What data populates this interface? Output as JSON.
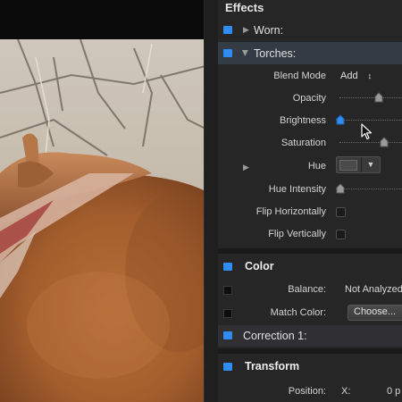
{
  "inspector": {
    "title": "Effects",
    "worn": {
      "label": "Worn:"
    },
    "torches": {
      "label": "Torches:",
      "blend_mode": {
        "label": "Blend Mode",
        "value": "Add",
        "arrow": "↕"
      },
      "opacity": {
        "label": "Opacity"
      },
      "brightness": {
        "label": "Brightness"
      },
      "saturation": {
        "label": "Saturation"
      },
      "hue": {
        "label": "Hue"
      },
      "hue_intensity": {
        "label": "Hue Intensity"
      },
      "flip_horizontally": {
        "label": "Flip Horizontally"
      },
      "flip_vertically": {
        "label": "Flip Vertically"
      }
    },
    "color": {
      "title": "Color",
      "balance": {
        "label": "Balance:",
        "value": "Not Analyzed"
      },
      "match_color": {
        "label": "Match Color:",
        "button": "Choose..."
      },
      "correction": {
        "label": "Correction 1:"
      }
    },
    "transform": {
      "title": "Transform",
      "position": {
        "label": "Position:",
        "x_label": "X:",
        "x_value": "0 p"
      }
    }
  },
  "colors": {
    "accent": "#2f8df2",
    "panel": "#262627"
  }
}
